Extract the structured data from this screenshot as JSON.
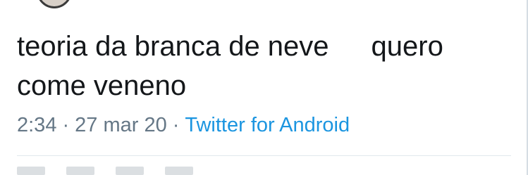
{
  "tweet": {
    "line1_a": "teoria da branca de neve",
    "line1_b": "quero",
    "line2": "come veneno"
  },
  "meta": {
    "time": "2:34",
    "separator": "·",
    "date": "27 mar 20",
    "source": "Twitter for Android"
  },
  "colors": {
    "text": "#14171a",
    "meta": "#657786",
    "link": "#1b95e0",
    "divider": "#e1e8ed"
  }
}
